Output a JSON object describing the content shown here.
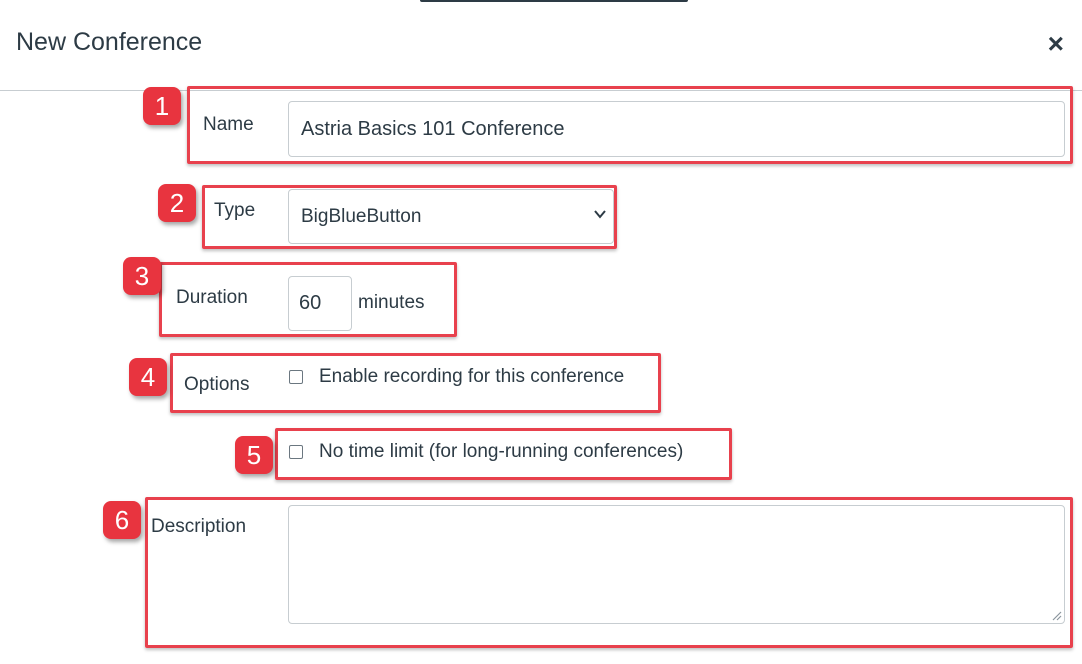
{
  "dialog": {
    "title": "New Conference",
    "close_label": "×"
  },
  "form": {
    "name": {
      "label": "Name",
      "value": "Astria Basics 101 Conference"
    },
    "type": {
      "label": "Type",
      "selected": "BigBlueButton"
    },
    "duration": {
      "label": "Duration",
      "value": "60",
      "unit": "minutes"
    },
    "options": {
      "label": "Options",
      "recording": {
        "label": "Enable recording for this conference",
        "checked": false
      },
      "no_time_limit": {
        "label": "No time limit (for long-running conferences)",
        "checked": false
      }
    },
    "description": {
      "label": "Description",
      "value": ""
    }
  },
  "annotations": [
    "1",
    "2",
    "3",
    "4",
    "5",
    "6"
  ],
  "colors": {
    "highlight": "#e8414d",
    "badge": "#e8343f",
    "text": "#2d3b45",
    "border": "#c7cdd1"
  }
}
